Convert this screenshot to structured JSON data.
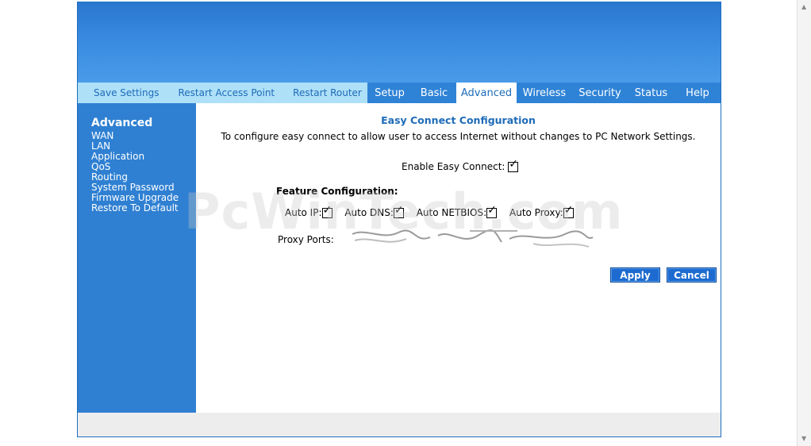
{
  "nav": {
    "quick_links": [
      "Save Settings",
      "Restart Access Point",
      "Restart Router"
    ],
    "tabs": [
      "Setup",
      "Basic",
      "Advanced",
      "Wireless",
      "Security",
      "Status",
      "Help"
    ],
    "active_tab": "Advanced"
  },
  "sidebar": {
    "title": "Advanced",
    "items": [
      "WAN",
      "LAN",
      "Application",
      "QoS",
      "Routing",
      "System Password",
      "Firmware Upgrade",
      "Restore To Default"
    ]
  },
  "main": {
    "title": "Easy Connect Configuration",
    "description": "To configure easy connect to allow user to access Internet without changes to PC Network Settings.",
    "enable_label": "Enable Easy Connect:",
    "enable_checked": true,
    "feature_title": "Feature Configuration:",
    "features": [
      {
        "label": "Auto IP:",
        "checked": true
      },
      {
        "label": "Auto DNS:",
        "checked": true
      },
      {
        "label": "Auto NETBIOS:",
        "checked": true
      },
      {
        "label": "Auto Proxy:",
        "checked": true
      }
    ],
    "proxy_label": "Proxy Ports:",
    "proxy_value": "",
    "apply_label": "Apply",
    "cancel_label": "Cancel"
  },
  "watermark": "PcWinTech.com",
  "colors": {
    "banner": "#3b8de2",
    "tab_bar": "#2f83d6",
    "quick_bar": "#aee0f8",
    "sidebar": "#2f80d2",
    "accent_text": "#1d6bb8",
    "button": "#1d6bd0"
  }
}
